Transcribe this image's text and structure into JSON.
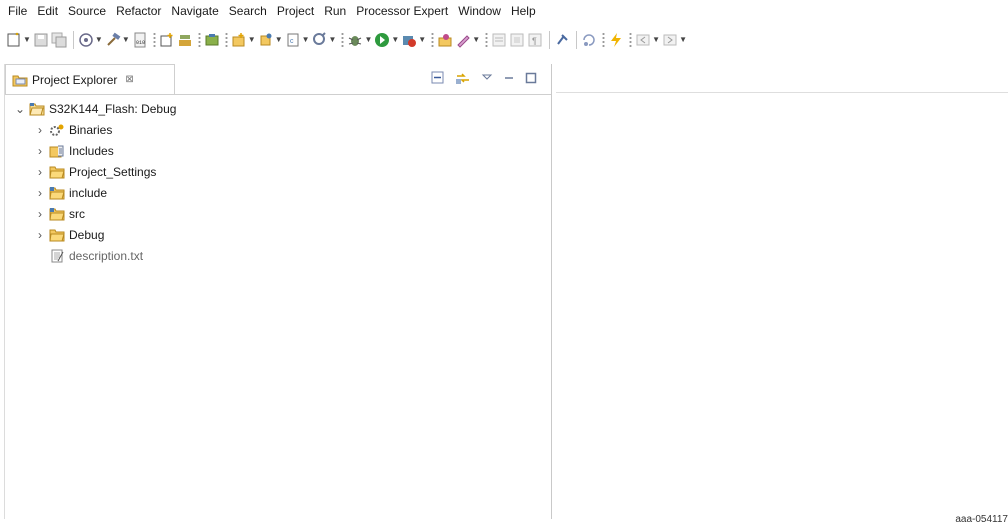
{
  "menubar": {
    "items": [
      "File",
      "Edit",
      "Source",
      "Refactor",
      "Navigate",
      "Search",
      "Project",
      "Run",
      "Processor Expert",
      "Window",
      "Help"
    ]
  },
  "toolbar": {
    "buttons": [
      "new",
      "save",
      "save-all",
      "debug-config",
      "build",
      "binary",
      "new-connection",
      "new-package",
      "new-class",
      "new-folder",
      "new-file",
      "new-item",
      "debug",
      "run",
      "external-tools",
      "search",
      "highlight",
      "toggle-mark",
      "toggle-block",
      "whitespace",
      "pin",
      "next-annotation",
      "prev-annotation",
      "back",
      "forward"
    ]
  },
  "explorer": {
    "title": "Project Explorer",
    "close_glyph": "⊠",
    "tree": {
      "project": "S32K144_Flash: Debug",
      "children": [
        {
          "label": "Binaries",
          "icon": "binaries-icon"
        },
        {
          "label": "Includes",
          "icon": "includes-icon"
        },
        {
          "label": "Project_Settings",
          "icon": "folder-icon"
        },
        {
          "label": "include",
          "icon": "source-folder-icon"
        },
        {
          "label": "src",
          "icon": "source-folder-icon"
        },
        {
          "label": "Debug",
          "icon": "folder-icon"
        },
        {
          "label": "description.txt",
          "icon": "text-file-icon"
        }
      ]
    }
  },
  "footnote": "aaa-054117"
}
